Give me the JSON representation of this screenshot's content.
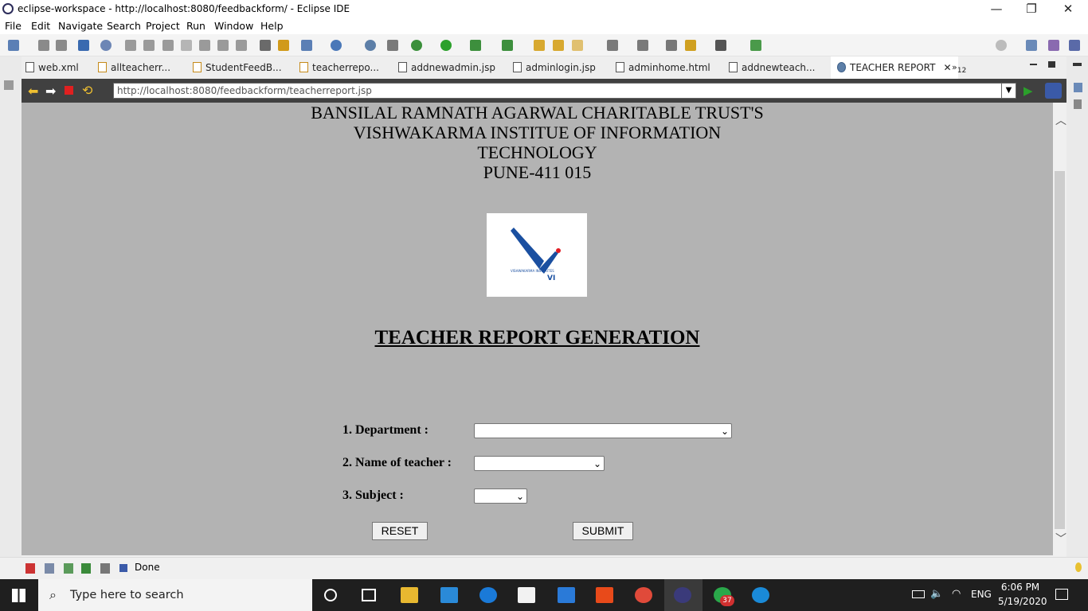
{
  "window": {
    "title": "eclipse-workspace - http://localhost:8080/feedbackform/ - Eclipse IDE",
    "minimize_glyph": "—",
    "restore_glyph": "❐",
    "close_glyph": "✕"
  },
  "menu": [
    "File",
    "Edit",
    "Navigate",
    "Search",
    "Project",
    "Run",
    "Window",
    "Help"
  ],
  "tabs": [
    {
      "label": "web.xml"
    },
    {
      "label": "allteacherr..."
    },
    {
      "label": "StudentFeedB..."
    },
    {
      "label": "teacherrepo..."
    },
    {
      "label": "addnewadmin.jsp"
    },
    {
      "label": "adminlogin.jsp"
    },
    {
      "label": "adminhome.html"
    },
    {
      "label": "addnewteach..."
    },
    {
      "label": "TEACHER REPORT",
      "active": true
    }
  ],
  "tab_overflow": {
    "glyph": "»",
    "count": "12"
  },
  "browser": {
    "url": "http://localhost:8080/feedbackform/teacherreport.jsp"
  },
  "page": {
    "header_lines": [
      "BANSILAL RAMNATH AGARWAL CHARITABLE TRUST'S",
      "VISHWAKARMA INSTITUE OF INFORMATION",
      "TECHNOLOGY",
      "PUNE-411 015"
    ],
    "logo": {
      "text_small": "VISHWAKARMA INSTITUTES",
      "text_big": "VI",
      "colors": {
        "primary": "#1a4fa0",
        "accent": "#e21b23"
      }
    },
    "report_title": "TEACHER REPORT GENERATION",
    "form": {
      "department_label": "1. Department :",
      "teacher_label": "2. Name of teacher :",
      "subject_label": "3. Subject :",
      "department_value": "",
      "teacher_value": "",
      "subject_value": "",
      "reset_label": "RESET",
      "submit_label": "SUBMIT"
    }
  },
  "status": {
    "text": "Done"
  },
  "taskbar": {
    "search_placeholder": "Type here to search",
    "whatsapp_badge": "37",
    "language": "ENG",
    "time": "6:06 PM",
    "date": "5/19/2020"
  },
  "colors": {
    "content_bg": "#b3b3b3",
    "navbar_bg": "#404040",
    "taskbar_bg": "#1f1f1f"
  }
}
